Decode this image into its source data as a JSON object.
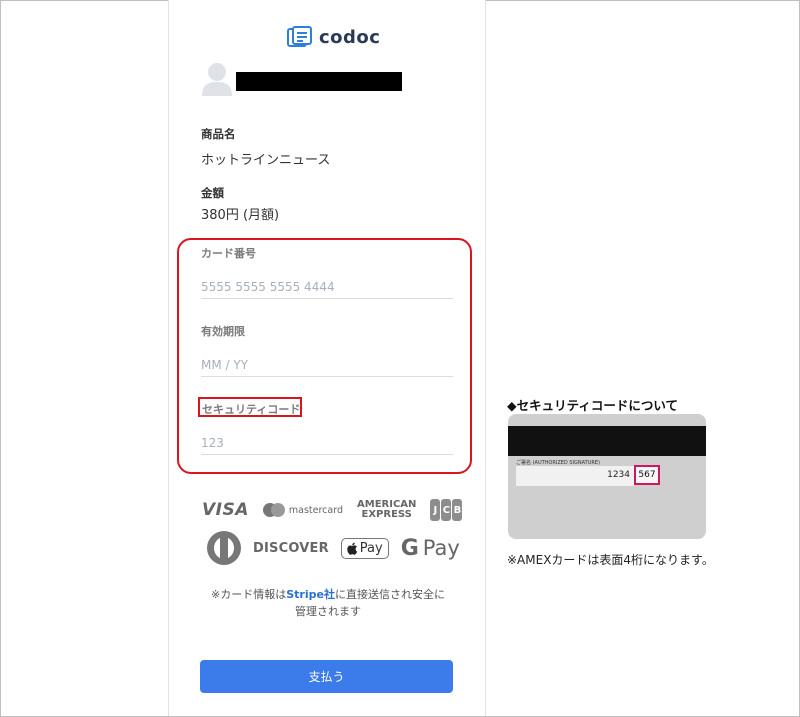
{
  "brand": {
    "name": "codoc",
    "logo_icon": "document-stack-icon"
  },
  "account": {
    "avatar_icon": "user-avatar-icon"
  },
  "product": {
    "label": "商品名",
    "value": "ホットラインニュース"
  },
  "price": {
    "label": "金額",
    "value": "380円 (月額)"
  },
  "card_form": {
    "number_label": "カード番号",
    "number_placeholder": "5555 5555 5555 4444",
    "expiry_label": "有効期限",
    "expiry_placeholder": "MM / YY",
    "cvc_label": "セキュリティコード",
    "cvc_placeholder": "123",
    "highlight_color": "#d9151d"
  },
  "card_brands": {
    "visa": "VISA",
    "mastercard": "mastercard",
    "amex_line1": "AMERICAN",
    "amex_line2": "EXPRESS",
    "jcb": [
      "J",
      "C",
      "B"
    ],
    "discover": "DISCOVER",
    "applepay": "Pay",
    "googlepay": "Pay",
    "googlepay_g": "G"
  },
  "secure_note": {
    "before": "※カード情報は",
    "link": "Stripe社",
    "after": "に直接送信され安全に管理されます"
  },
  "pay_button": {
    "label": "支払う",
    "color": "#3c7bea"
  },
  "cvc_help": {
    "title": "◆セキュリティコードについて",
    "signature_label": "ご署名 (AUTHORIZED SIGNATURE)",
    "card_digits": "1234",
    "cvc_digits": "567",
    "note": "※AMEXカードは表面4桁になります。"
  }
}
